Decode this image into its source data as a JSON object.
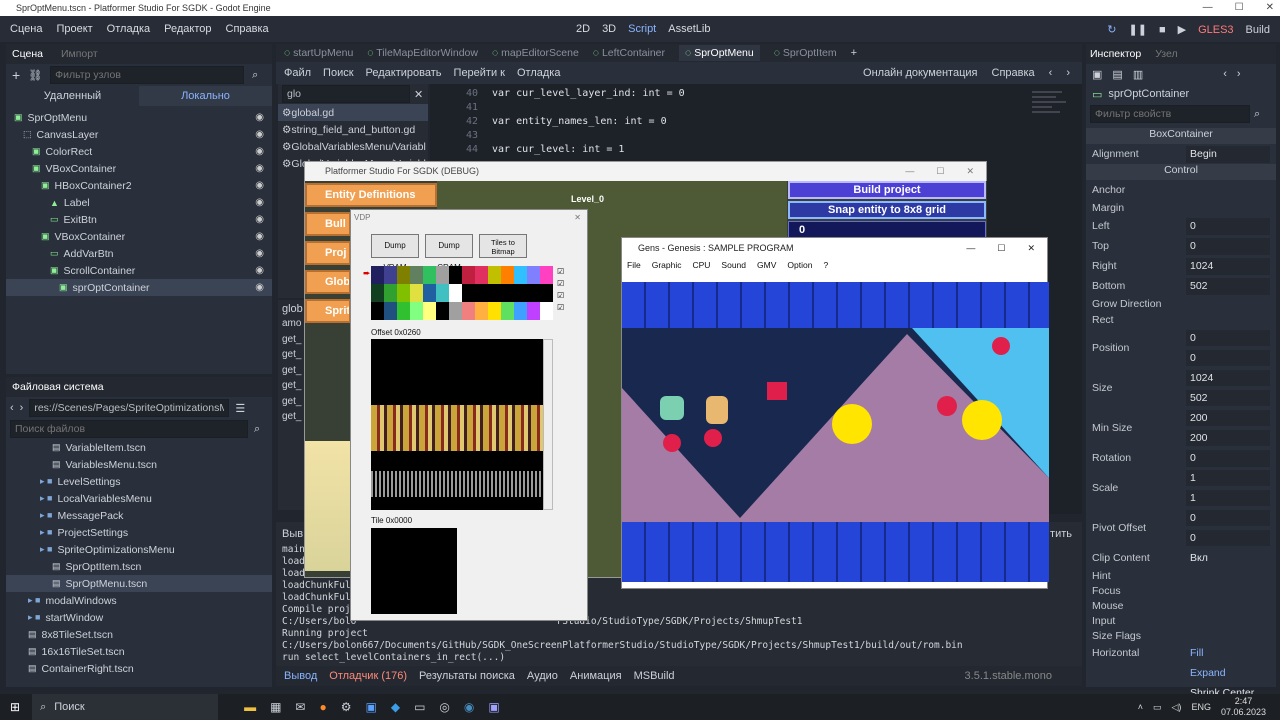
{
  "window": {
    "title": "SprOptMenu.tscn - Platformer Studio For SGDK - Godot Engine"
  },
  "menu": [
    "Сцена",
    "Проект",
    "Отладка",
    "Редактор",
    "Справка"
  ],
  "workspace": {
    "btn_2d": "2D",
    "btn_3d": "3D",
    "btn_script": "Script",
    "btn_assetlib": "AssetLib"
  },
  "right_top": {
    "renderer": "GLES3",
    "build": "Build"
  },
  "scene_panel": {
    "tab_scene": "Сцена",
    "tab_import": "Импорт",
    "filter_placeholder": "Фильтр узлов",
    "remote": "Удаленный",
    "local": "Локально",
    "nodes": [
      {
        "label": "SprOptMenu",
        "indent": 0,
        "icon": "control"
      },
      {
        "label": "CanvasLayer",
        "indent": 1,
        "icon": "canvas"
      },
      {
        "label": "ColorRect",
        "indent": 2,
        "icon": "control"
      },
      {
        "label": "VBoxContainer",
        "indent": 2,
        "icon": "control"
      },
      {
        "label": "HBoxContainer2",
        "indent": 3,
        "icon": "control"
      },
      {
        "label": "Label",
        "indent": 4,
        "icon": "label"
      },
      {
        "label": "ExitBtn",
        "indent": 4,
        "icon": "button"
      },
      {
        "label": "VBoxContainer",
        "indent": 3,
        "icon": "control"
      },
      {
        "label": "AddVarBtn",
        "indent": 4,
        "icon": "button"
      },
      {
        "label": "ScrollContainer",
        "indent": 4,
        "icon": "control"
      },
      {
        "label": "sprOptContainer",
        "indent": 5,
        "icon": "control"
      }
    ]
  },
  "fs_panel": {
    "title": "Файловая система",
    "path": "res://Scenes/Pages/SpriteOptimizationsMenu",
    "search_placeholder": "Поиск файлов",
    "items": [
      {
        "label": "VariableItem.tscn",
        "indent": 2,
        "kind": "file"
      },
      {
        "label": "VariablesMenu.tscn",
        "indent": 2,
        "kind": "file"
      },
      {
        "label": "LevelSettings",
        "indent": 1,
        "kind": "folder"
      },
      {
        "label": "LocalVariablesMenu",
        "indent": 1,
        "kind": "folder"
      },
      {
        "label": "MessagePack",
        "indent": 1,
        "kind": "folder"
      },
      {
        "label": "ProjectSettings",
        "indent": 1,
        "kind": "folder"
      },
      {
        "label": "SpriteOptimizationsMenu",
        "indent": 1,
        "kind": "folder"
      },
      {
        "label": "SprOptItem.tscn",
        "indent": 2,
        "kind": "file"
      },
      {
        "label": "SprOptMenu.tscn",
        "indent": 2,
        "kind": "file"
      },
      {
        "label": "modalWindows",
        "indent": 0,
        "kind": "folder"
      },
      {
        "label": "startWindow",
        "indent": 0,
        "kind": "folder"
      },
      {
        "label": "8x8TileSet.tscn",
        "indent": 0,
        "kind": "file"
      },
      {
        "label": "16x16TileSet.tscn",
        "indent": 0,
        "kind": "file"
      },
      {
        "label": "ContainerRight.tscn",
        "indent": 0,
        "kind": "file"
      }
    ]
  },
  "editor_tabs": [
    "startUpMenu",
    "TileMapEditorWindow",
    "mapEditorScene",
    "LeftContainer",
    "SprOptMenu",
    "SprOptItem"
  ],
  "script_menu": [
    "Файл",
    "Поиск",
    "Редактировать",
    "Перейти к",
    "Отладка"
  ],
  "script_right": {
    "docs": "Онлайн документация",
    "help": "Справка"
  },
  "script_filter": "glo",
  "script_files": [
    "global.gd",
    "string_field_and_button.gd",
    "GlobalVariablesMenu/Variabl",
    "GlobalVariablesMenu/Variabl"
  ],
  "code": [
    {
      "n": "40",
      "text": "var cur_level_layer_ind: int = 0"
    },
    {
      "n": "41",
      "text": ""
    },
    {
      "n": "42",
      "text": "var entity_names_len: int = 0"
    },
    {
      "n": "43",
      "text": ""
    },
    {
      "n": "44",
      "text": "var cur_level: int = 1"
    }
  ],
  "methods_panel": {
    "title": "glob",
    "items": [
      "amo",
      "get_",
      "get_",
      "get_",
      "get_",
      "get_",
      "get_"
    ]
  },
  "output": {
    "lines": [
      "main",
      "load",
      "load",
      "loadChunkFull",
      "loadChunkFull",
      "Compile proje",
      "C:/Users/bolo                                   rStudio/StudioType/SGDK/Projects/ShmupTest1",
      "Running project",
      "C:/Users/bolon667/Documents/GitHub/SGDK_OneScreenPlatformerStudio/StudioType/SGDK/Projects/ShmupTest1/build/out/rom.bin",
      "run select_levelContainers_in_rect(...)"
    ],
    "short_left": "Выв",
    "clear_btn": "тить"
  },
  "bottom_tabs": [
    "Вывод",
    "Отладчик (176)",
    "Результаты поиска",
    "Аудио",
    "Анимация",
    "MSBuild"
  ],
  "version": "3.5.1.stable.mono",
  "inspector": {
    "tab_inspector": "Инспектор",
    "tab_node": "Узел",
    "node_name": "sprOptContainer",
    "filter_placeholder": "Фильтр свойств",
    "section_box": "BoxContainer",
    "alignment_label": "Alignment",
    "alignment_value": "Begin",
    "section_control": "Control",
    "anchor": "Anchor",
    "margin": "Margin",
    "margins": [
      {
        "k": "Left",
        "v": "0"
      },
      {
        "k": "Top",
        "v": "0"
      },
      {
        "k": "Right",
        "v": "1024"
      },
      {
        "k": "Bottom",
        "v": "502"
      }
    ],
    "grow": "Grow Direction",
    "rect": "Rect",
    "position_label": "Position",
    "position": [
      "0",
      "0"
    ],
    "size_label": "Size",
    "size": [
      "1024",
      "502"
    ],
    "minsize_label": "Min Size",
    "minsize": [
      "200",
      "200"
    ],
    "rotation_label": "Rotation",
    "rotation": "0",
    "scale_label": "Scale",
    "scale": [
      "1",
      "1"
    ],
    "pivot_label": "Pivot Offset",
    "pivot": [
      "0",
      "0"
    ],
    "clip_label": "Clip Content",
    "clip_value": "Вкл",
    "hint": "Hint",
    "focus": "Focus",
    "mouse": "Mouse",
    "input": "Input",
    "sizeflags": "Size Flags",
    "horizontal": "Horizontal",
    "fill": "Fill",
    "expand": "Expand",
    "shrink": "Shrink Center"
  },
  "game_window": {
    "title": "Platformer Studio For SGDK (DEBUG)",
    "left_buttons": [
      "Entity Definitions",
      "Bull",
      "Proj",
      "Glob",
      "Sprite"
    ],
    "level_label": "Level_0",
    "right_buttons": [
      "Build project",
      "Snap entity to 8x8 grid"
    ],
    "counter": "0"
  },
  "vdp": {
    "title": "VDP",
    "btn_dump_vram": "Dump VRAM",
    "btn_dump_cram": "Dump CRAM",
    "btn_tiles": "Tiles to Bitmap",
    "offset": "Offset 0x0260",
    "tile": "Tile 0x0000"
  },
  "gens": {
    "title": "Gens - Genesis : SAMPLE PROGRAM",
    "menu": [
      "File",
      "Graphic",
      "CPU",
      "Sound",
      "GMV",
      "Option",
      "?"
    ]
  },
  "taskbar": {
    "search": "Поиск",
    "lang": "ENG",
    "time": "2:47",
    "date": "07.06.2023"
  }
}
